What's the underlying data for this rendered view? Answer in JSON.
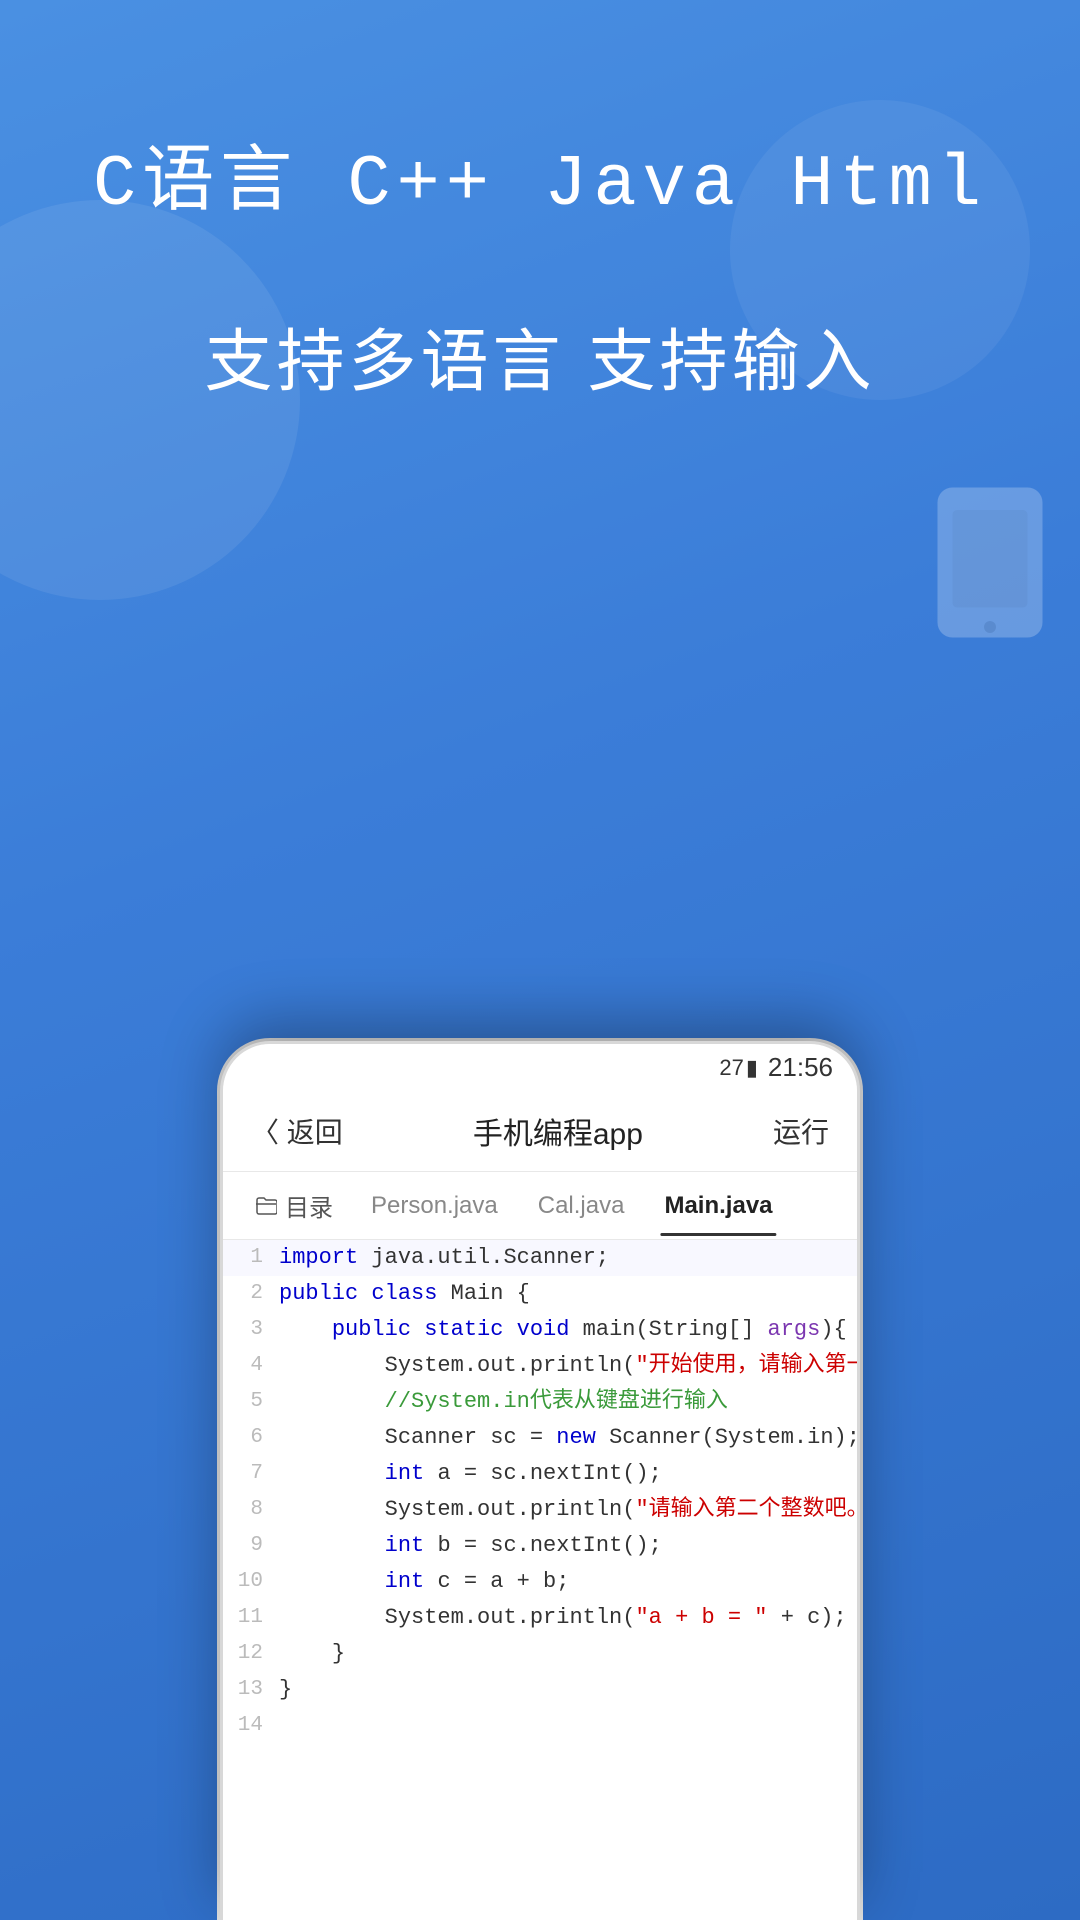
{
  "background": {
    "gradient_start": "#4a90e2",
    "gradient_end": "#2d6bc4"
  },
  "header": {
    "lang_title": "C语言  C++  Java  Html",
    "subtitle": "支持多语言  支持输入"
  },
  "status_bar": {
    "battery": "27",
    "time": "21:56"
  },
  "app_bar": {
    "back_label": "〈 返回",
    "title": "手机编程app",
    "run_label": "运行"
  },
  "tabs": [
    {
      "label": "目录",
      "active": false,
      "is_folder": true
    },
    {
      "label": "Person.java",
      "active": false
    },
    {
      "label": "Cal.java",
      "active": false
    },
    {
      "label": "Main.java",
      "active": true
    }
  ],
  "code_lines": [
    {
      "num": "1",
      "content": "import java.util.Scanner;"
    },
    {
      "num": "2",
      "content": "public class Main {"
    },
    {
      "num": "3",
      "content": "    public static void main(String[] args){"
    },
    {
      "num": "4",
      "content": "        System.out.println(\"开始使用，请输入第一个整数吧。\");"
    },
    {
      "num": "5",
      "content": "        //System.in代表从键盘进行输入"
    },
    {
      "num": "6",
      "content": "        Scanner sc = new Scanner(System.in);"
    },
    {
      "num": "7",
      "content": "        int a = sc.nextInt();"
    },
    {
      "num": "8",
      "content": "        System.out.println(\"请输入第二个整数吧。\");"
    },
    {
      "num": "9",
      "content": "        int b = sc.nextInt();"
    },
    {
      "num": "10",
      "content": "        int c = a + b;"
    },
    {
      "num": "11",
      "content": "        System.out.println(\"a + b = \" + c);"
    },
    {
      "num": "12",
      "content": "    }"
    },
    {
      "num": "13",
      "content": "}"
    },
    {
      "num": "14",
      "content": ""
    }
  ]
}
